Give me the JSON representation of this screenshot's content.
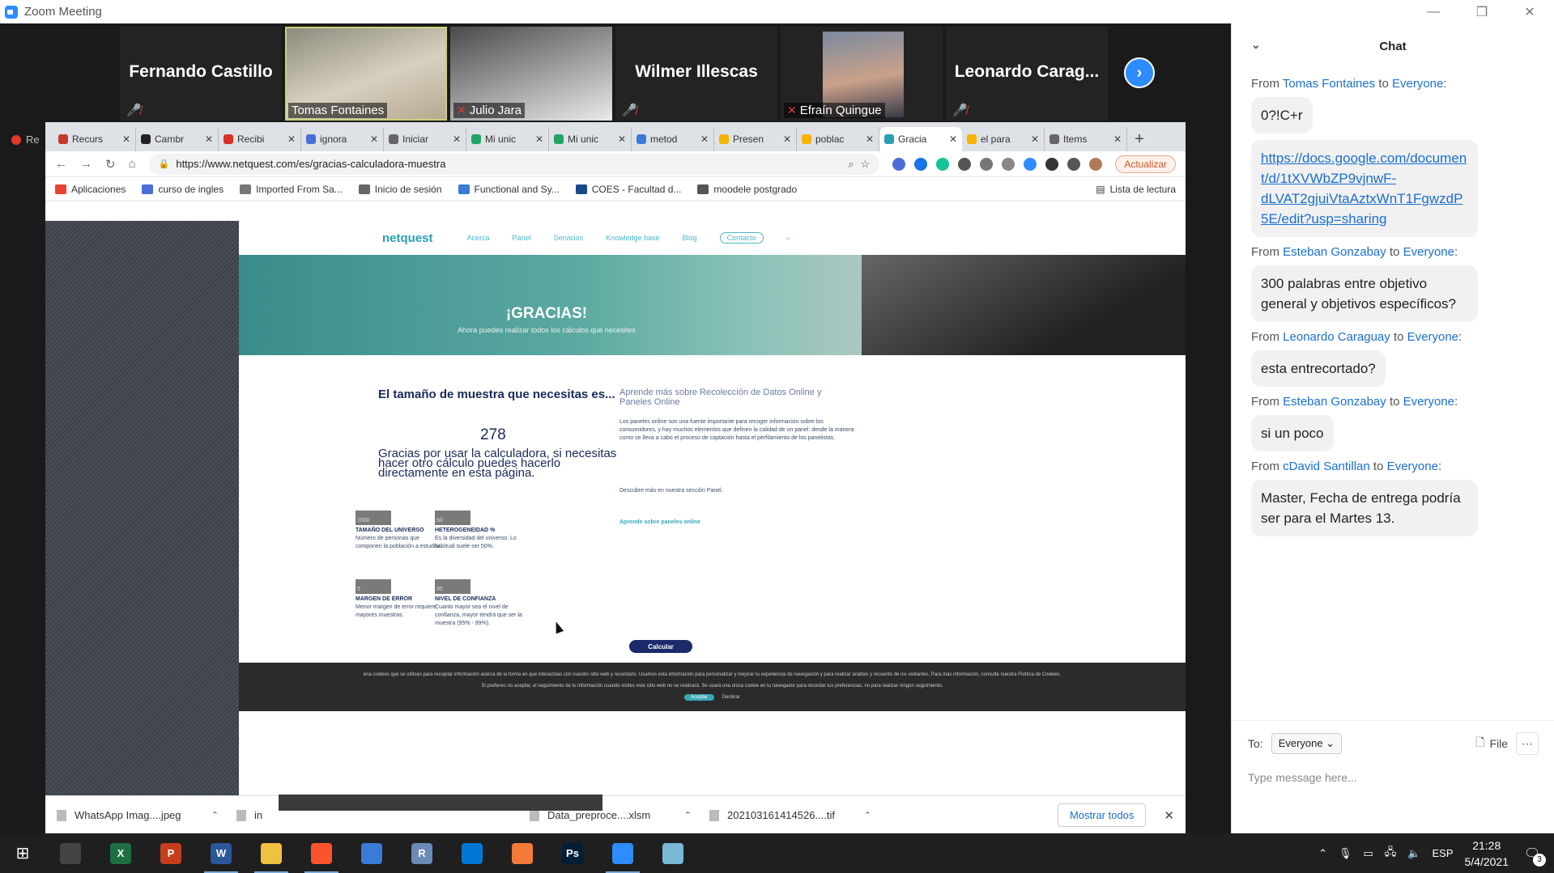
{
  "window": {
    "title": "Zoom Meeting",
    "minimize": "—",
    "restore": "❐",
    "close": "✕"
  },
  "participants": [
    {
      "name": "Fernando Castillo",
      "video": false,
      "muted": true
    },
    {
      "name": "Tomas Fontaines",
      "video": true,
      "muted": false,
      "active_speaker": true
    },
    {
      "name": "Julio Jara",
      "video": true,
      "muted": true
    },
    {
      "name": "Wilmer Illescas",
      "video": false,
      "muted": true
    },
    {
      "name": "Efraín Quingue",
      "video": true,
      "muted": true
    },
    {
      "name": "Leonardo Carag...",
      "video": false,
      "muted": true
    }
  ],
  "recording_label": "Re",
  "browser": {
    "tabs": [
      {
        "label": "Recurs",
        "color": "#c0392b"
      },
      {
        "label": "Cambr",
        "color": "#222222"
      },
      {
        "label": "Recibi",
        "color": "#d93025"
      },
      {
        "label": "ignora",
        "color": "#4a6ed8"
      },
      {
        "label": "Iniciar",
        "color": "#666666"
      },
      {
        "label": "Mi unic",
        "color": "#1fa463"
      },
      {
        "label": "Mi unic",
        "color": "#1fa463"
      },
      {
        "label": "metod",
        "color": "#3a7bd5"
      },
      {
        "label": "Presen",
        "color": "#f4b400"
      },
      {
        "label": "poblac",
        "color": "#f4b400"
      },
      {
        "label": "Gracia",
        "color": "#2a9fb5",
        "active": true
      },
      {
        "label": "el para",
        "color": "#f4b400"
      },
      {
        "label": "Items",
        "color": "#666666"
      }
    ],
    "url": "https://www.netquest.com/es/gracias-calculadora-muestra",
    "update_label": "Actualizar",
    "bookmarks": [
      "Aplicaciones",
      "curso de ingles",
      "Imported From Sa...",
      "Inicio de sesión",
      "Functional and Sy...",
      "COES - Facultad d...",
      "moodele postgrado"
    ],
    "reading_list": "Lista de lectura"
  },
  "site": {
    "logo": "netquest",
    "nav": [
      "Acerca",
      "Panel",
      "Servicios",
      "Knowledge base",
      "Blog"
    ],
    "contact": "Contacto",
    "hero_title": "¡GRACIAS!",
    "hero_sub": "Ahora puedes realizar todos los cálculos que necesites",
    "sample_title": "El tamaño de muestra que necesitas es...",
    "sample_value": "278",
    "thanks_text": "Gracias por usar la calculadora, si necesitas hacer otro cálculo puedes hacerlo directamente en esta página.",
    "right_title": "Aprende más sobre Recolección de Datos Online y Paneles Online",
    "right_body": "Los paneles online son una fuente importante para recoger información sobre los consumidores, y hay muchos elementos que definen la calidad de un panel: desde la manera como se lleva a cabo el proceso de captación hasta el perfilamiento de los panelistas.",
    "right_link": "Descubre más en nuestra sección Panel.",
    "right_link2": "Aprende sobre paneles online",
    "params": [
      {
        "value": "1000",
        "label": "TAMAÑO DEL UNIVERSO",
        "desc": "Número de personas que componen la población a estudiar."
      },
      {
        "value": "50",
        "label": "HETEROGENEIDAD %",
        "desc": "Es la diversidad del universo. Lo habitual suele ser 50%."
      },
      {
        "value": "5",
        "label": "MARGEN DE ERROR",
        "desc": "Menor margen de error requiere mayores muestras."
      },
      {
        "value": "95",
        "label": "NIVEL DE CONFIANZA",
        "desc": "Cuanto mayor sea el nivel de confianza, mayor tendrá que ser la muestra (95% - 99%)."
      }
    ],
    "calc_button": "Calcular",
    "cookie_line1": "ena cookies que se utilizan para recopilar información acerca de la forma en que interactúas con nuestro sitio web y recordarlo. Usamos esta información para personalizar y mejorar tu experiencia de navegación y para realizar análisis y recuento de los visitantes. Para más información, consulte nuestra Política de Cookies.",
    "cookie_line2": "Si prefieres no aceptar, el seguimiento de tu información cuando visites este sitio web no se realizará. Se usará una única cookie en tu navegador para recordar tus preferencias, no para realizar ningún seguimiento.",
    "cookie_accept": "Aceptar",
    "cookie_decline": "Declinar"
  },
  "downloads": {
    "items": [
      "WhatsApp Imag....jpeg",
      "in",
      "Data_preproce....xlsm",
      "202103161414526....tif"
    ],
    "show_all": "Mostrar todos"
  },
  "chat": {
    "title": "Chat",
    "messages": [
      {
        "from": "Tomas Fontaines",
        "to": "Everyone",
        "text": "0?!C+r"
      },
      {
        "from": "",
        "to": "",
        "text": "https://docs.google.com/document/d/1tXVWbZP9vjnwF-dLVAT2gjuiVtaAztxWnT1FgwzdP5E/edit?usp=sharing",
        "link": true
      },
      {
        "from": "Esteban Gonzabay",
        "to": "Everyone",
        "text": "300 palabras entre objetivo general y objetivos específicos?"
      },
      {
        "from": "Leonardo Caraguay",
        "to": "Everyone",
        "text": "esta entrecortado?"
      },
      {
        "from": "Esteban Gonzabay",
        "to": "Everyone",
        "text": "si un poco"
      },
      {
        "from": "cDavid Santillan",
        "to": "Everyone",
        "text": "Master, Fecha de entrega podría ser para el Martes 13."
      }
    ],
    "from_word": "From",
    "to_word": "to",
    "to_label": "To:",
    "to_value": "Everyone",
    "file_label": "File",
    "input_placeholder": "Type message here..."
  },
  "taskbar": {
    "apps": [
      {
        "name": "pen-app",
        "label": "",
        "color": "#444444"
      },
      {
        "name": "excel",
        "label": "X",
        "color": "#1d6f42"
      },
      {
        "name": "powerpoint",
        "label": "P",
        "color": "#c43e1c"
      },
      {
        "name": "word",
        "label": "W",
        "color": "#2b579a",
        "open": true
      },
      {
        "name": "file-explorer",
        "label": "",
        "color": "#f0c040",
        "open": true
      },
      {
        "name": "brave",
        "label": "",
        "color": "#fb542b",
        "open": true
      },
      {
        "name": "control-panel",
        "label": "",
        "color": "#3a7bd5"
      },
      {
        "name": "r-app",
        "label": "R",
        "color": "#6a8ab8"
      },
      {
        "name": "vscode",
        "label": "",
        "color": "#0078d4"
      },
      {
        "name": "orange-app",
        "label": "",
        "color": "#f47a3a"
      },
      {
        "name": "photoshop",
        "label": "Ps",
        "color": "#001e36"
      },
      {
        "name": "zoom",
        "label": "",
        "color": "#2D8CFF",
        "open": true
      },
      {
        "name": "notepad",
        "label": "",
        "color": "#7ab8d8"
      }
    ],
    "lang": "ESP",
    "time": "21:28",
    "date": "5/4/2021",
    "notif_count": "3"
  }
}
